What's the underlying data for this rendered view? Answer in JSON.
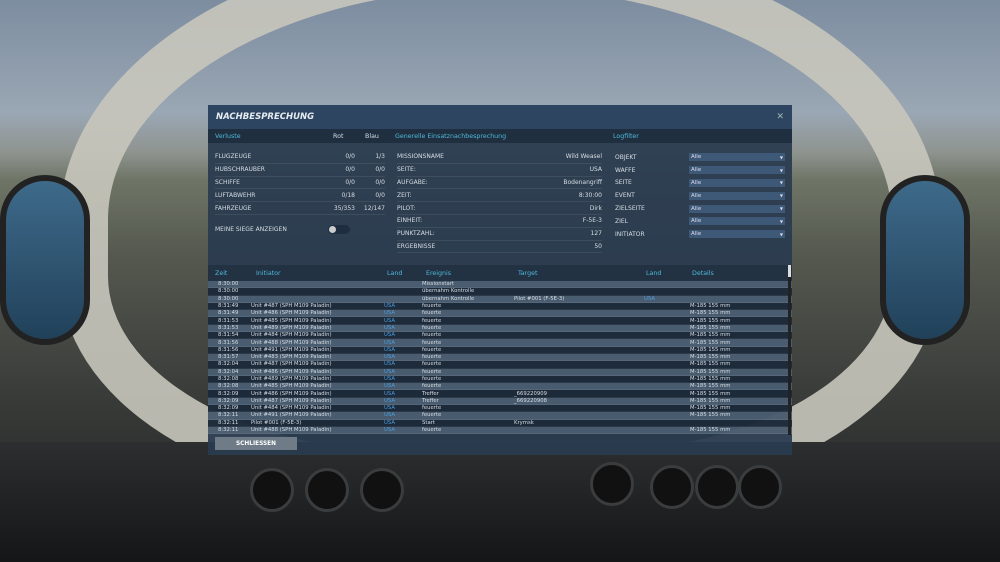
{
  "dialog": {
    "title": "NACHBESPRECHUNG",
    "close_icon": "close-icon"
  },
  "losses": {
    "header": "Verluste",
    "col_red": "Rot",
    "col_blue": "Blau",
    "rows": [
      {
        "label": "FLUGZEUGE",
        "red": "0/0",
        "blue": "1/3"
      },
      {
        "label": "HUBSCHRAUBER",
        "red": "0/0",
        "blue": "0/0"
      },
      {
        "label": "SCHIFFE",
        "red": "0/0",
        "blue": "0/0"
      },
      {
        "label": "LUFTABWEHR",
        "red": "0/18",
        "blue": "0/0"
      },
      {
        "label": "FAHRZEUGE",
        "red": "35/353",
        "blue": "12/147"
      }
    ],
    "toggle_label": "MEINE SIEGE ANZEIGEN",
    "toggle_on": false
  },
  "general": {
    "header": "Generelle Einsatznachbesprechung",
    "rows": [
      {
        "label": "MISSIONSNAME",
        "value": "Wild Weasel"
      },
      {
        "label": "SEITE:",
        "value": "USA"
      },
      {
        "label": "AUFGABE:",
        "value": "Bodenangriff"
      },
      {
        "label": "ZEIT:",
        "value": "8:30:00"
      },
      {
        "label": "PILOT:",
        "value": "Dirk"
      },
      {
        "label": "EINHEIT:",
        "value": "F-5E-3"
      },
      {
        "label": "PUNKTZAHL:",
        "value": "127"
      },
      {
        "label": "ERGEBNISSE",
        "value": "50"
      }
    ]
  },
  "logfilter": {
    "header": "Logfilter",
    "rows": [
      {
        "label": "OBJEKT",
        "value": "Alle"
      },
      {
        "label": "WAFFE",
        "value": "Alle"
      },
      {
        "label": "SEITE",
        "value": "Alle"
      },
      {
        "label": "EVENT",
        "value": "Alle"
      },
      {
        "label": "ZIELSEITE",
        "value": "Alle"
      },
      {
        "label": "ZIEL",
        "value": "Alle"
      },
      {
        "label": "INITIATOR",
        "value": "Alle"
      }
    ]
  },
  "log": {
    "columns": [
      "Zeit",
      "Initiator",
      "Land",
      "Ereignis",
      "Target",
      "Land",
      "Details"
    ],
    "rows": [
      [
        "8:30:00",
        "",
        "",
        "Missionstart",
        "",
        "",
        ""
      ],
      [
        "8:30:00",
        "",
        "",
        "übernahm Kontrolle",
        "",
        "",
        ""
      ],
      [
        "8:30:00",
        "",
        "",
        "übernahm Kontrolle",
        "Pilot #001 (F-5E-3)",
        "USA",
        ""
      ],
      [
        "8:31:49",
        "Unit #487 (SPH M109 Paladin)",
        "USA",
        "feuerte",
        "",
        "",
        "M-185 155 mm"
      ],
      [
        "8:31:49",
        "Unit #486 (SPH M109 Paladin)",
        "USA",
        "feuerte",
        "",
        "",
        "M-185 155 mm"
      ],
      [
        "8:31:53",
        "Unit #485 (SPH M109 Paladin)",
        "USA",
        "feuerte",
        "",
        "",
        "M-185 155 mm"
      ],
      [
        "8:31:53",
        "Unit #489 (SPH M109 Paladin)",
        "USA",
        "feuerte",
        "",
        "",
        "M-185 155 mm"
      ],
      [
        "8:31:54",
        "Unit #484 (SPH M109 Paladin)",
        "USA",
        "feuerte",
        "",
        "",
        "M-185 155 mm"
      ],
      [
        "8:31:56",
        "Unit #488 (SPH M109 Paladin)",
        "USA",
        "feuerte",
        "",
        "",
        "M-185 155 mm"
      ],
      [
        "8:31:56",
        "Unit #491 (SPH M109 Paladin)",
        "USA",
        "feuerte",
        "",
        "",
        "M-185 155 mm"
      ],
      [
        "8:31:57",
        "Unit #483 (SPH M109 Paladin)",
        "USA",
        "feuerte",
        "",
        "",
        "M-185 155 mm"
      ],
      [
        "8:32:04",
        "Unit #487 (SPH M109 Paladin)",
        "USA",
        "feuerte",
        "",
        "",
        "M-185 155 mm"
      ],
      [
        "8:32:04",
        "Unit #486 (SPH M109 Paladin)",
        "USA",
        "feuerte",
        "",
        "",
        "M-185 155 mm"
      ],
      [
        "8:32:08",
        "Unit #489 (SPH M109 Paladin)",
        "USA",
        "feuerte",
        "",
        "",
        "M-185 155 mm"
      ],
      [
        "8:32:08",
        "Unit #485 (SPH M109 Paladin)",
        "USA",
        "feuerte",
        "",
        "",
        "M-185 155 mm"
      ],
      [
        "8:32:09",
        "Unit #486 (SPH M109 Paladin)",
        "USA",
        "Treffer",
        "_669220909",
        "",
        "M-185 155 mm"
      ],
      [
        "8:32:09",
        "Unit #487 (SPH M109 Paladin)",
        "USA",
        "Treffer",
        "_669220908",
        "",
        "M-185 155 mm"
      ],
      [
        "8:32:09",
        "Unit #484 (SPH M109 Paladin)",
        "USA",
        "feuerte",
        "",
        "",
        "M-185 155 mm"
      ],
      [
        "8:32:11",
        "Unit #491 (SPH M109 Paladin)",
        "USA",
        "feuerte",
        "",
        "",
        "M-185 155 mm"
      ],
      [
        "8:32:11",
        "Pilot #001 (F-5E-3)",
        "USA",
        "Start",
        "Krymsk",
        "",
        ""
      ],
      [
        "8:32:11",
        "Unit #488 (SPH M109 Paladin)",
        "USA",
        "feuerte",
        "",
        "",
        "M-185 155 mm"
      ]
    ]
  },
  "close_button": "SCHLIESSEN"
}
